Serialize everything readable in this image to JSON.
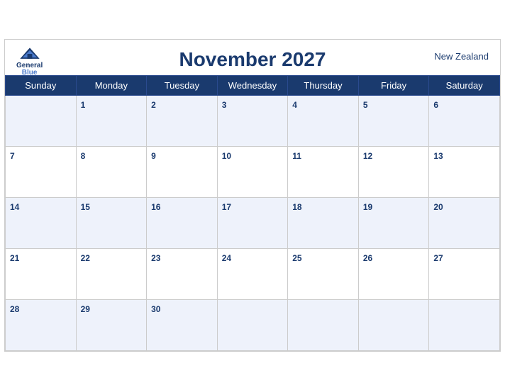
{
  "header": {
    "title": "November 2027",
    "country": "New Zealand",
    "logo_line1": "General",
    "logo_line2": "Blue"
  },
  "days_of_week": [
    "Sunday",
    "Monday",
    "Tuesday",
    "Wednesday",
    "Thursday",
    "Friday",
    "Saturday"
  ],
  "weeks": [
    [
      null,
      1,
      2,
      3,
      4,
      5,
      6
    ],
    [
      7,
      8,
      9,
      10,
      11,
      12,
      13
    ],
    [
      14,
      15,
      16,
      17,
      18,
      19,
      20
    ],
    [
      21,
      22,
      23,
      24,
      25,
      26,
      27
    ],
    [
      28,
      29,
      30,
      null,
      null,
      null,
      null
    ]
  ]
}
